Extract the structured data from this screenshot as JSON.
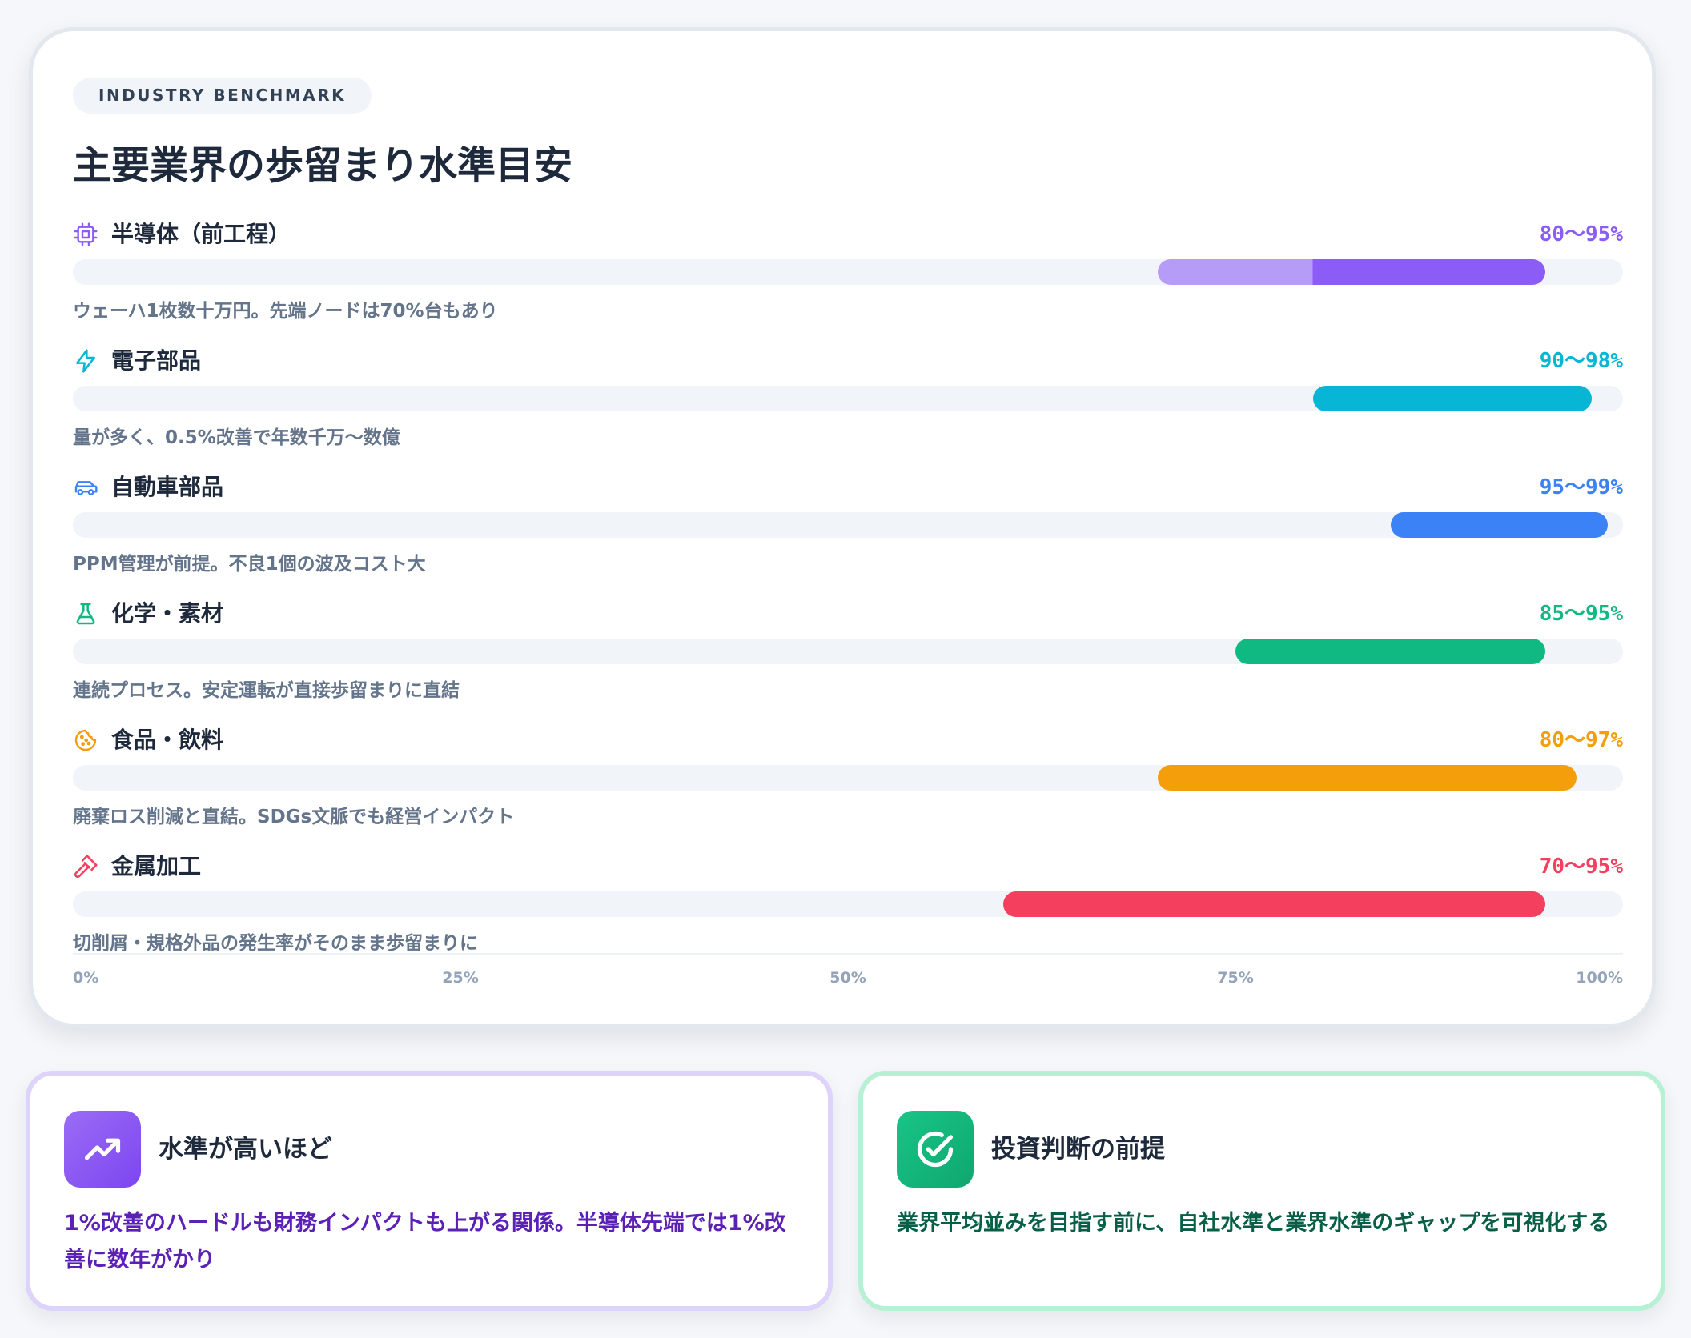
{
  "badge": "INDUSTRY BENCHMARK",
  "title": "主要業界の歩留まり水準目安",
  "chart_data": {
    "type": "bar",
    "orientation": "horizontal-range",
    "xlim": [
      0,
      100
    ],
    "x_unit": "%",
    "grid": false,
    "ticks": [
      "0%",
      "25%",
      "50%",
      "75%",
      "100%"
    ],
    "series": [
      {
        "name": "半導体（前工程）",
        "range_label": "80〜95%",
        "min": 70,
        "max": 95,
        "inner_min": 80,
        "description": "ウェーハ1枚数十万円。先端ノードは70%台もあり",
        "color": "#8b5cf6",
        "light_color": "#b79cf7",
        "icon": "chip-icon"
      },
      {
        "name": "電子部品",
        "range_label": "90〜98%",
        "min": 80,
        "max": 98,
        "description": "量が多く、0.5%改善で年数千万〜数億",
        "color": "#06b6d4",
        "icon": "lightning-icon"
      },
      {
        "name": "自動車部品",
        "range_label": "95〜99%",
        "min": 85,
        "max": 99,
        "description": "PPM管理が前提。不良1個の波及コスト大",
        "color": "#3b82f6",
        "icon": "car-icon"
      },
      {
        "name": "化学・素材",
        "range_label": "85〜95%",
        "min": 75,
        "max": 95,
        "description": "連続プロセス。安定運転が直接歩留まりに直結",
        "color": "#10b981",
        "icon": "flask-icon"
      },
      {
        "name": "食品・飲料",
        "range_label": "80〜97%",
        "min": 70,
        "max": 97,
        "description": "廃棄ロス削減と直結。SDGs文脈でも経営インパクト",
        "color": "#f59e0b",
        "icon": "cookie-icon"
      },
      {
        "name": "金属加工",
        "range_label": "70〜95%",
        "min": 60,
        "max": 95,
        "description": "切削屑・規格外品の発生率がそのまま歩留まりに",
        "color": "#f43f5e",
        "icon": "hammer-icon"
      }
    ]
  },
  "notes": [
    {
      "title": "水準が高いほど",
      "body": "1%改善のハードルも財務インパクトも上がる関係。半導体先端では1%改善に数年がかり",
      "icon": "trend-up-icon",
      "color": "#8b5cf6"
    },
    {
      "title": "投資判断の前提",
      "body": "業界平均並みを目指す前に、自社水準と業界水準のギャップを可視化する",
      "icon": "check-circle-icon",
      "color": "#10b981"
    }
  ]
}
